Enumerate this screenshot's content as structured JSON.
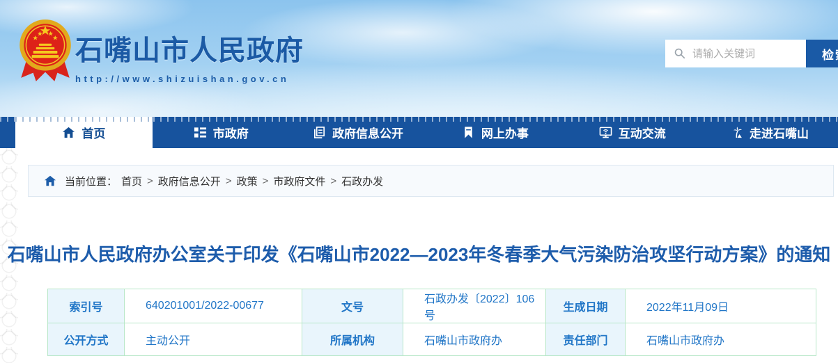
{
  "header": {
    "site_name": "石嘴山市人民政府",
    "site_url": "http://www.shizuishan.gov.cn",
    "search": {
      "placeholder": "请输入关键词",
      "button_label": "检索"
    }
  },
  "nav": {
    "items": [
      {
        "label": "首页",
        "icon": "home-icon",
        "active": true
      },
      {
        "label": "市政府",
        "icon": "list-blocks-icon",
        "active": false
      },
      {
        "label": "政府信息公开",
        "icon": "document-icon",
        "active": false
      },
      {
        "label": "网上办事",
        "icon": "bookmark-icon",
        "active": false
      },
      {
        "label": "互动交流",
        "icon": "monitor-wifi-icon",
        "active": false
      },
      {
        "label": "走进石嘴山",
        "icon": "palm-tree-icon",
        "active": false
      }
    ]
  },
  "breadcrumb": {
    "label": "当前位置：",
    "separator": ">",
    "items": [
      "首页",
      "政府信息公开",
      "政策",
      "市政府文件",
      "石政办发"
    ]
  },
  "document": {
    "title": "石嘴山市人民政府办公室关于印发《石嘴山市2022—2023年冬春季大气污染防治攻坚行动方案》的通知"
  },
  "info_table": {
    "rows": [
      [
        {
          "label": "索引号",
          "value": "640201001/2022-00677"
        },
        {
          "label": "文号",
          "value": "石政办发〔2022〕106号"
        },
        {
          "label": "生成日期",
          "value": "2022年11月09日"
        }
      ],
      [
        {
          "label": "公开方式",
          "value": "主动公开"
        },
        {
          "label": "所属机构",
          "value": "石嘴山市政府办"
        },
        {
          "label": "责任部门",
          "value": "石嘴山市政府办"
        }
      ]
    ]
  },
  "colors": {
    "nav_blue": "#17539e",
    "title_blue": "#1d5cab",
    "text_blue": "#2176c7",
    "table_border": "#b7e7c8",
    "label_cell_bg": "#e9f5fc",
    "search_button_bg": "#1a5aa6",
    "emblem_red": "#dd2218",
    "emblem_gold": "#e2a91c"
  }
}
